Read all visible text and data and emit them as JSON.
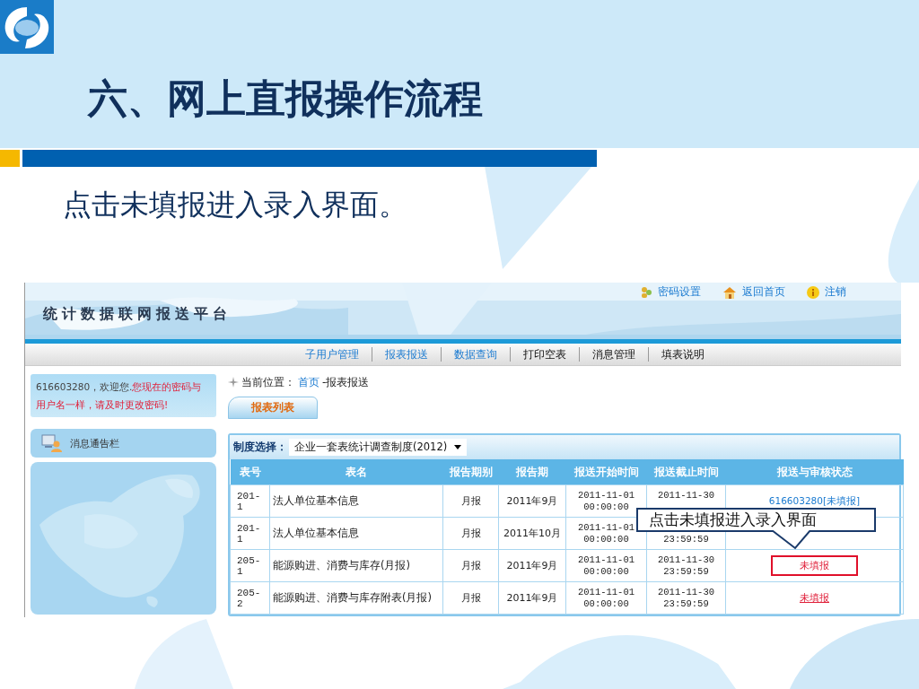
{
  "slide": {
    "title": "六、网上直报操作流程",
    "subtitle": "点击未填报进入录入界面。"
  },
  "site": {
    "title": "统计数据联网报送平台"
  },
  "top_links": [
    {
      "label": "密码设置"
    },
    {
      "label": "返回首页"
    },
    {
      "label": "注销"
    }
  ],
  "nav": [
    {
      "label": "子用户管理",
      "kind": "link"
    },
    {
      "label": "报表报送",
      "kind": "link"
    },
    {
      "label": "数据查询",
      "kind": "link"
    },
    {
      "label": "打印空表",
      "kind": "plain"
    },
    {
      "label": "消息管理",
      "kind": "plain"
    },
    {
      "label": "填表说明",
      "kind": "plain"
    }
  ],
  "welcome": {
    "greeting": "616603280，欢迎您.",
    "warning": "您现在的密码与用户名一样，请及时更改密码!"
  },
  "notice": {
    "title": "消息通告栏"
  },
  "breadcrumb": {
    "label": "当前位置：",
    "home": "首页",
    "current": "-报表报送"
  },
  "tabs": [
    {
      "label": "报表列表",
      "selected": true
    }
  ],
  "system_select": {
    "label": "制度选择：",
    "value": "企业一套表统计调查制度(2012)"
  },
  "table": {
    "columns": [
      "表号",
      "表名",
      "报告期别",
      "报告期",
      "报送开始时间",
      "报送截止时间",
      "报送与审核状态"
    ],
    "rows": [
      {
        "code": "201-1",
        "name": "法人单位基本信息",
        "period_type": "月报",
        "period": "2011年9月",
        "start": {
          "date": "2011-11-01",
          "time": "00:00:00"
        },
        "end": {
          "date": "2011-11-30"
        },
        "status": {
          "kind": "user",
          "text": "616603280[未填报]"
        }
      },
      {
        "code": "201-1",
        "name": "法人单位基本信息",
        "period_type": "月报",
        "period": "2011年10月",
        "start": {
          "date": "2011-11-01",
          "time": "00:00:00"
        },
        "end": {
          "time": "23:59:59"
        }
      },
      {
        "code": "205-1",
        "name": "能源购进、消费与库存(月报)",
        "period_type": "月报",
        "period": "2011年9月",
        "start": {
          "date": "2011-11-01",
          "time": "00:00:00"
        },
        "end": {
          "date": "2011-11-30",
          "time": "23:59:59"
        },
        "status": {
          "kind": "unfilled",
          "text": "未填报"
        },
        "highlighted": true
      },
      {
        "code": "205-2",
        "name": "能源购进、消费与库存附表(月报)",
        "period_type": "月报",
        "period": "2011年9月",
        "start": {
          "date": "2011-11-01",
          "time": "00:00:00"
        },
        "end": {
          "date": "2011-11-30",
          "time": "23:59:59"
        },
        "status": {
          "kind": "unfilled",
          "text": "未填报"
        }
      }
    ]
  },
  "callout": {
    "text": "点击未填报进入录入界面"
  }
}
